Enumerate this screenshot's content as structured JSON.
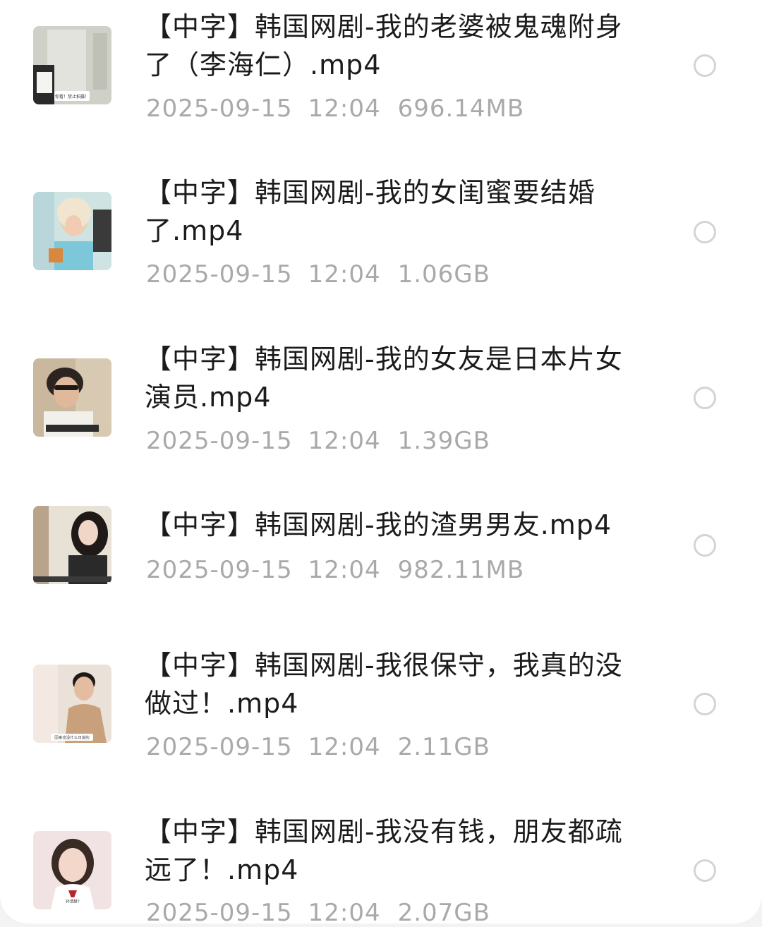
{
  "files": [
    {
      "title": "【中字】韩国网剧-我的老婆被鬼魂附身了（李海仁）.mp4",
      "date": "2025-09-15",
      "time": "12:04",
      "size": "696.14MB",
      "thumbnail": {
        "caption": "你看！禁止拍摄！"
      }
    },
    {
      "title": "【中字】韩国网剧-我的女闺蜜要结婚了.mp4",
      "date": "2025-09-15",
      "time": "12:04",
      "size": "1.06GB",
      "thumbnail": {
        "caption": ""
      }
    },
    {
      "title": "【中字】韩国网剧-我的女友是日本片女演员.mp4",
      "date": "2025-09-15",
      "time": "12:04",
      "size": "1.39GB",
      "thumbnail": {
        "caption": ""
      }
    },
    {
      "title": "【中字】韩国网剧-我的渣男男友.mp4",
      "date": "2025-09-15",
      "time": "12:04",
      "size": "982.11MB",
      "thumbnail": {
        "caption": ""
      }
    },
    {
      "title": "【中字】韩国网剧-我很保守，我真的没做过！.mp4",
      "date": "2025-09-15",
      "time": "12:04",
      "size": "2.11GB",
      "thumbnail": {
        "caption": "回来也没什么可说的"
      }
    },
    {
      "title": "【中字】韩国网剧-我没有钱，朋友都疏远了！.mp4",
      "date": "2025-09-15",
      "time": "12:04",
      "size": "2.07GB",
      "thumbnail": {
        "caption": "孙浩赫?"
      }
    }
  ]
}
